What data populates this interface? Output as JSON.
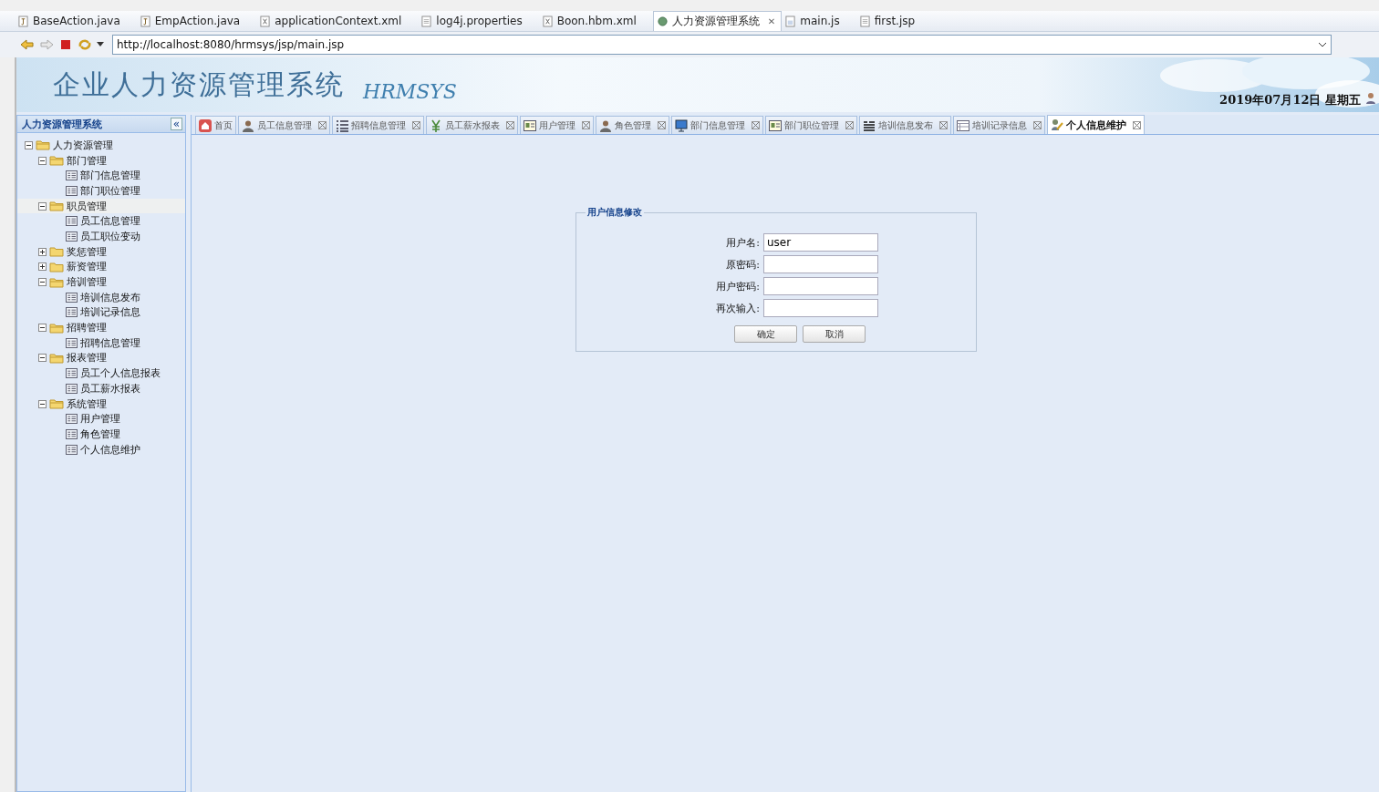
{
  "editor_tabs": [
    {
      "label": "BaseAction.java",
      "kind": "java",
      "selected": false
    },
    {
      "label": "EmpAction.java",
      "kind": "java",
      "selected": false
    },
    {
      "label": "applicationContext.xml",
      "kind": "xml",
      "selected": false
    },
    {
      "label": "log4j.properties",
      "kind": "file",
      "selected": false
    },
    {
      "label": "Boon.hbm.xml",
      "kind": "xml",
      "selected": false
    },
    {
      "label": "人力资源管理系统",
      "kind": "web",
      "selected": true,
      "close": "✕"
    },
    {
      "label": "main.js",
      "kind": "js",
      "selected": false
    },
    {
      "label": "first.jsp",
      "kind": "file",
      "selected": false
    }
  ],
  "address_bar": {
    "url": "http://localhost:8080/hrmsys/jsp/main.jsp"
  },
  "header": {
    "title": "企业人力资源管理系统",
    "subtitle": "HRMSYS",
    "date": "2019年07月12日 星期五"
  },
  "sidebar": {
    "title": "人力资源管理系统",
    "collapse": "«",
    "tree": [
      {
        "label": "人力资源管理",
        "expanded": true,
        "selected": false,
        "children": [
          {
            "label": "部门管理",
            "expanded": true,
            "selected": false,
            "children": [
              {
                "label": "部门信息管理",
                "selected": false
              },
              {
                "label": "部门职位管理",
                "selected": false
              }
            ]
          },
          {
            "label": "职员管理",
            "expanded": true,
            "selected": true,
            "children": [
              {
                "label": "员工信息管理",
                "selected": false
              },
              {
                "label": "员工职位变动",
                "selected": false
              }
            ]
          },
          {
            "label": "奖惩管理",
            "expanded": false,
            "selected": false
          },
          {
            "label": "薪资管理",
            "expanded": false,
            "selected": false
          },
          {
            "label": "培训管理",
            "expanded": true,
            "selected": false,
            "children": [
              {
                "label": "培训信息发布",
                "selected": false
              },
              {
                "label": "培训记录信息",
                "selected": false
              }
            ]
          },
          {
            "label": "招聘管理",
            "expanded": true,
            "selected": false,
            "children": [
              {
                "label": "招聘信息管理",
                "selected": false
              }
            ]
          },
          {
            "label": "报表管理",
            "expanded": true,
            "selected": false,
            "children": [
              {
                "label": "员工个人信息报表",
                "selected": false
              },
              {
                "label": "员工薪水报表",
                "selected": false
              }
            ]
          },
          {
            "label": "系统管理",
            "expanded": true,
            "selected": false,
            "children": [
              {
                "label": "用户管理",
                "selected": false
              },
              {
                "label": "角色管理",
                "selected": false
              },
              {
                "label": "个人信息维护",
                "selected": false
              }
            ]
          }
        ]
      }
    ]
  },
  "tabs": [
    {
      "label": "首页",
      "kind": "home",
      "selected": false,
      "closable": false
    },
    {
      "label": "员工信息管理",
      "kind": "person",
      "selected": false,
      "closable": true
    },
    {
      "label": "招聘信息管理",
      "kind": "list",
      "selected": false,
      "closable": true
    },
    {
      "label": "员工薪水报表",
      "kind": "money",
      "selected": false,
      "closable": true
    },
    {
      "label": "用户管理",
      "kind": "card",
      "selected": false,
      "closable": true
    },
    {
      "label": "角色管理",
      "kind": "person",
      "selected": false,
      "closable": true
    },
    {
      "label": "部门信息管理",
      "kind": "monitor",
      "selected": false,
      "closable": true
    },
    {
      "label": "部门职位管理",
      "kind": "card",
      "selected": false,
      "closable": true
    },
    {
      "label": "培训信息发布",
      "kind": "lines",
      "selected": false,
      "closable": true
    },
    {
      "label": "培训记录信息",
      "kind": "table",
      "selected": false,
      "closable": true
    },
    {
      "label": "个人信息维护",
      "kind": "edit",
      "selected": true,
      "closable": true
    }
  ],
  "form": {
    "legend": "用户信息修改",
    "fields": [
      {
        "label": "用户名:",
        "value": "user"
      },
      {
        "label": "原密码:"
      },
      {
        "label": "用户密码:"
      },
      {
        "label": "再次输入:"
      }
    ],
    "buttons": [
      "确定",
      "取消"
    ]
  }
}
